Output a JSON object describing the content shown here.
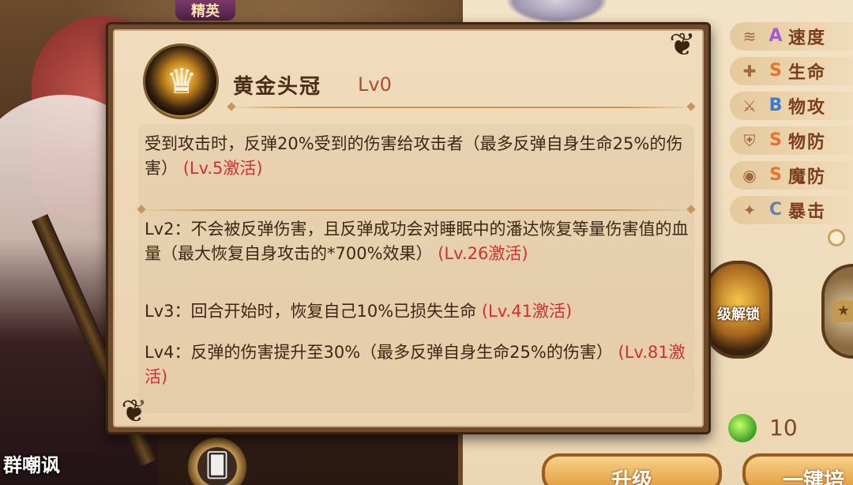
{
  "background": {
    "tab_elite": "精英",
    "skill_caption": "群嘲讽",
    "card_icon": "cards-icon"
  },
  "stats": [
    {
      "icon": "speed-icon",
      "grade": "A",
      "grade_color": "#a45bd6",
      "name": "速度"
    },
    {
      "icon": "health-icon",
      "grade": "S",
      "grade_color": "#e8732c",
      "name": "生命"
    },
    {
      "icon": "attack-icon",
      "grade": "B",
      "grade_color": "#3a7bd6",
      "name": "物攻"
    },
    {
      "icon": "defense-icon",
      "grade": "S",
      "grade_color": "#e8732c",
      "name": "物防"
    },
    {
      "icon": "magic-defense-icon",
      "grade": "S",
      "grade_color": "#e8732c",
      "name": "魔防"
    },
    {
      "icon": "crit-icon",
      "grade": "C",
      "grade_color": "#6a7fb0",
      "name": "暴击"
    }
  ],
  "unlock_medal_label": "级解锁",
  "potion_count": "10",
  "buttons": {
    "upgrade": "升级",
    "one_key": "一键培"
  },
  "popup": {
    "skill_name": "黄金头冠",
    "skill_level": "Lv0",
    "desc": {
      "text": "受到攻击时，反弹20%受到的伤害给攻击者（最多反弹自身生命25%的伤害）",
      "activation": "(Lv.5激活)"
    },
    "upgrades": [
      {
        "text": "Lv2：不会被反弹伤害，且反弹成功会对睡眠中的潘达恢复等量伤害值的血量（最大恢复自身攻击的*700%效果）",
        "activation": "(Lv.26激活)"
      },
      {
        "text": "Lv3：回合开始时，恢复自己10%已损失生命",
        "activation": "(Lv.41激活)"
      },
      {
        "text": "Lv4：反弹的伤害提升至30%（最多反弹自身生命25%的伤害）",
        "activation": "(Lv.81激活)"
      }
    ]
  },
  "colors": {
    "activation": "#d0302e",
    "level": "#b04a2c",
    "parchment": "#f0dcbd"
  }
}
